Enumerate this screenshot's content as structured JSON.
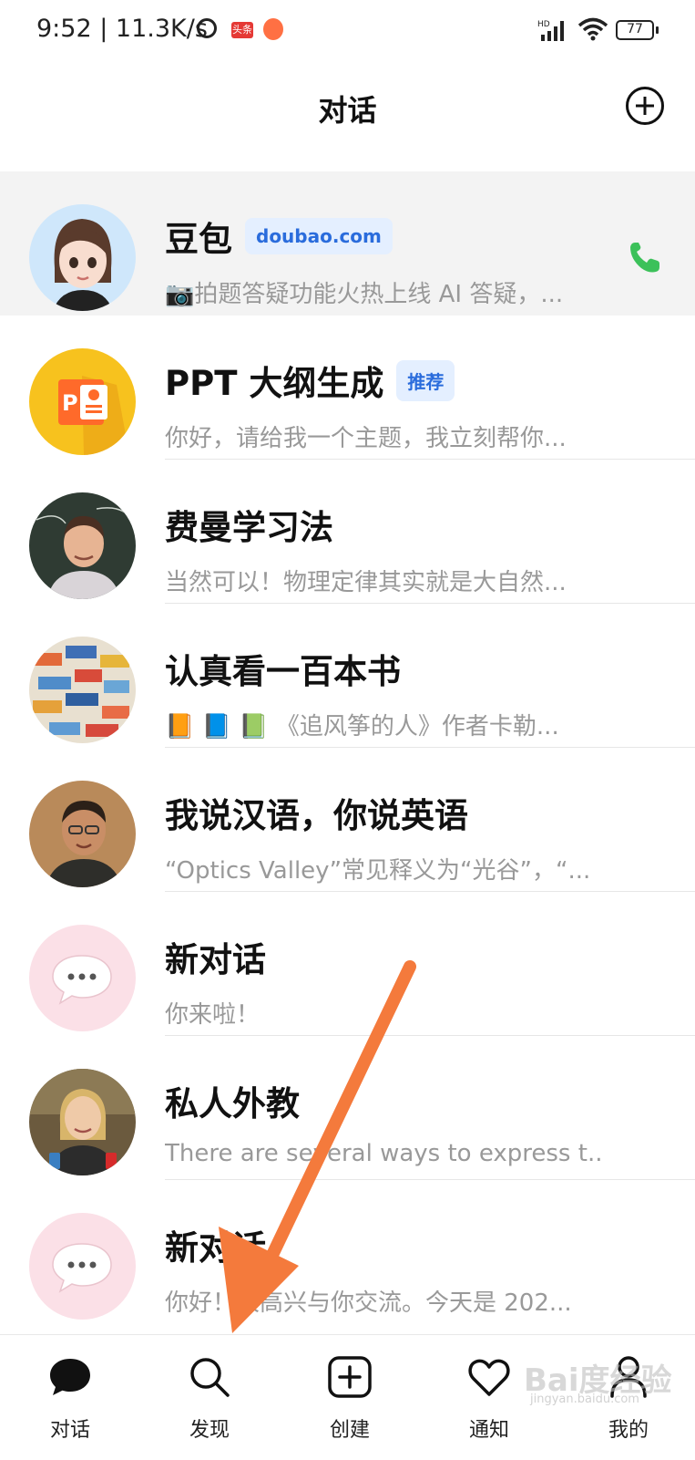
{
  "status_bar": {
    "time": "9:52 | 11.3K/s",
    "app_badge_1": "头条",
    "battery": "77"
  },
  "header": {
    "title": "对话"
  },
  "conversations": [
    {
      "name": "豆包",
      "tag": "doubao.com",
      "preview": "📷拍题答疑功能火热上线 AI 答疑，...",
      "avatar": "doubao-avatar",
      "active": true
    },
    {
      "name": "PPT 大纲生成",
      "tag": "推荐",
      "preview": "你好，请给我一个主题，我立刻帮你...",
      "avatar": "ppt-avatar"
    },
    {
      "name": "费曼学习法",
      "tag": "",
      "preview": "当然可以！物理定律其实就是大自然...",
      "avatar": "feynman-avatar"
    },
    {
      "name": "认真看一百本书",
      "tag": "",
      "preview": "📙 📘 📗 《追风筝的人》作者卡勒...",
      "avatar": "books-avatar"
    },
    {
      "name": "我说汉语，你说英语",
      "tag": "",
      "preview": "“Optics Valley”常见释义为“光谷”，“...",
      "avatar": "translator-avatar"
    },
    {
      "name": "新对话",
      "tag": "",
      "preview": "你来啦！",
      "avatar": "chat-bubble-avatar"
    },
    {
      "name": "私人外教",
      "tag": "",
      "preview": "There are several ways to express t...",
      "avatar": "tutor-avatar"
    },
    {
      "name": "新对话",
      "tag": "",
      "preview": "你好！很高兴与你交流。今天是 202...",
      "avatar": "chat-bubble-avatar"
    }
  ],
  "bottom_nav": [
    {
      "label": "对话",
      "icon": "chat-bubble-icon"
    },
    {
      "label": "发现",
      "icon": "search-icon"
    },
    {
      "label": "创建",
      "icon": "plus-square-icon"
    },
    {
      "label": "通知",
      "icon": "heart-icon"
    },
    {
      "label": "我的",
      "icon": "person-icon"
    }
  ],
  "watermark": {
    "brand": "Bai度经验",
    "url": "jingyan.baidu.com"
  },
  "colors": {
    "accent_tag_bg": "#e4efff",
    "accent_tag_text": "#2a6cdc",
    "call_green": "#3cc15a",
    "arrow_orange": "#f47a3c"
  }
}
